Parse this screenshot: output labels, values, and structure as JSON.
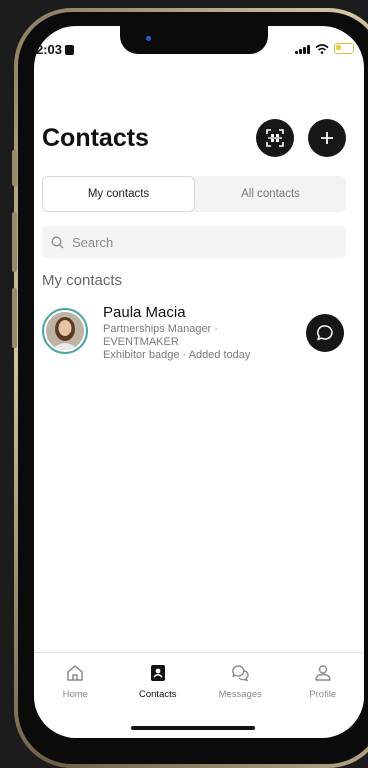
{
  "status_bar": {
    "time": "2:03"
  },
  "header": {
    "title": "Contacts"
  },
  "tabs": [
    {
      "label": "My contacts",
      "active": true
    },
    {
      "label": "All contacts",
      "active": false
    }
  ],
  "search": {
    "placeholder": "Search",
    "value": ""
  },
  "section": {
    "label": "My contacts"
  },
  "contacts": [
    {
      "name": "Paula Macia",
      "role_line": "Partnerships Manager ·",
      "company": "EVENTMAKER",
      "meta": "Exhibitor badge · Added today"
    }
  ],
  "bottom_nav": [
    {
      "label": "Home",
      "icon": "home-icon",
      "active": false
    },
    {
      "label": "Contacts",
      "icon": "contacts-icon",
      "active": true
    },
    {
      "label": "Messages",
      "icon": "messages-icon",
      "active": false
    },
    {
      "label": "Profile",
      "icon": "profile-icon",
      "active": false
    }
  ],
  "colors": {
    "accent": "#171717",
    "avatar_ring": "#4aa6a0",
    "battery": "#e7d23f"
  }
}
